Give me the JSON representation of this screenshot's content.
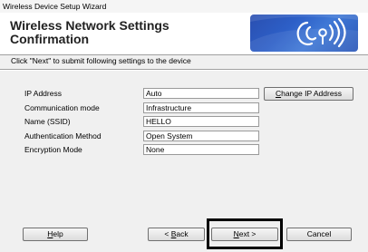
{
  "window": {
    "title": "Wireless Device Setup Wizard"
  },
  "header": {
    "title_line1": "Wireless Network Settings",
    "title_line2": "Confirmation"
  },
  "instruction": "Click \"Next\" to submit following settings to the device",
  "settings": [
    {
      "label": "IP Address",
      "value": "Auto"
    },
    {
      "label": "Communication mode",
      "value": "Infrastructure"
    },
    {
      "label": "Name (SSID)",
      "value": "HELLO"
    },
    {
      "label": "Authentication Method",
      "value": "Open System"
    },
    {
      "label": "Encryption Mode",
      "value": "None"
    }
  ],
  "buttons": {
    "change_ip": {
      "mnemonic": "C",
      "rest": "hange IP Address"
    },
    "help": {
      "mnemonic": "H",
      "rest": "elp"
    },
    "back": {
      "prefix": "< ",
      "mnemonic": "B",
      "rest": "ack"
    },
    "next": {
      "mnemonic": "N",
      "rest": "ext >"
    },
    "cancel": "Cancel"
  },
  "icons": {
    "logo": "wireless-logo-icon"
  }
}
